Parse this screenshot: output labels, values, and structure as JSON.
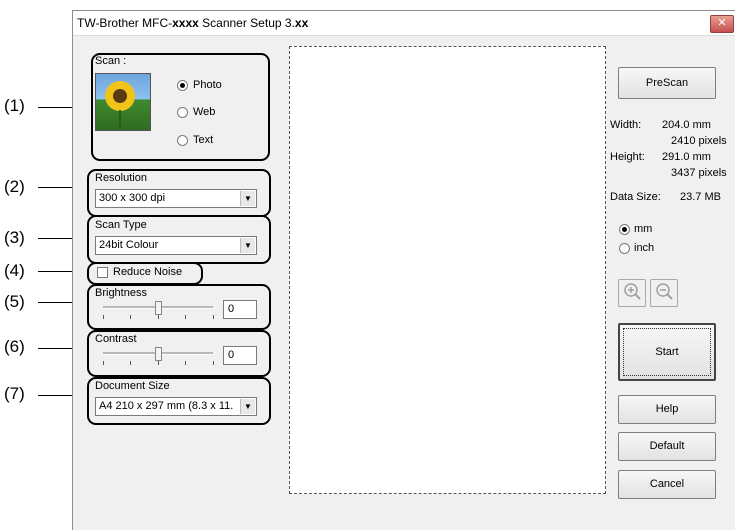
{
  "window": {
    "title_prefix": "TW-Brother MFC-",
    "title_model": "xxxx",
    "title_middle": " Scanner Setup 3.",
    "title_version": "xx",
    "close_glyph": "✕"
  },
  "callouts": [
    "(1)",
    "(2)",
    "(3)",
    "(4)",
    "(5)",
    "(6)",
    "(7)"
  ],
  "scan": {
    "label": "Scan :",
    "options": [
      "Photo",
      "Web",
      "Text"
    ],
    "selected": "Photo"
  },
  "resolution": {
    "label": "Resolution",
    "value": "300 x 300 dpi"
  },
  "scan_type": {
    "label": "Scan Type",
    "value": "24bit Colour"
  },
  "reduce_noise": {
    "label": "Reduce Noise",
    "checked": false
  },
  "brightness": {
    "label": "Brightness",
    "value": "0",
    "level": 0.5
  },
  "contrast": {
    "label": "Contrast",
    "value": "0",
    "level": 0.5
  },
  "document_size": {
    "label": "Document Size",
    "value": "A4 210 x 297 mm (8.3 x 11."
  },
  "buttons": {
    "prescan": "PreScan",
    "start": "Start",
    "help": "Help",
    "default": "Default",
    "cancel": "Cancel"
  },
  "info": {
    "width_label": "Width:",
    "width_mm": "204.0 mm",
    "width_px": "2410 pixels",
    "height_label": "Height:",
    "height_mm": "291.0 mm",
    "height_px": "3437 pixels",
    "datasize_label": "Data Size:",
    "datasize_value": "23.7 MB"
  },
  "units": {
    "options": [
      "mm",
      "inch"
    ],
    "selected": "mm"
  },
  "icons": {
    "zoom_in": "zoom-in-icon",
    "zoom_out": "zoom-out-icon"
  }
}
